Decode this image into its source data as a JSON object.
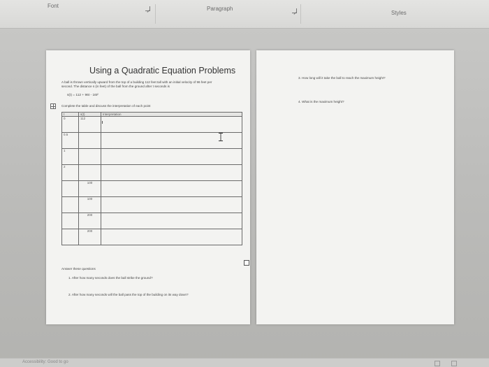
{
  "ribbon": {
    "font_label": "Font",
    "paragraph_label": "Paragraph",
    "styles_label": "Styles"
  },
  "worksheet": {
    "title": "Using a Quadratic Equation Problems",
    "intro_line1": "A ball is thrown vertically upward from the top of a building 112 feet tall with an initial velocity of 96 feet per",
    "intro_line2": "second. The distance s (in feet) of the ball from the ground after t seconds is",
    "formula": "s(t) = 112 + 96t - 16t²",
    "instruction": "Complete the table and discuss the interpretation of each point",
    "table": {
      "headers": [
        "t",
        "s(t)",
        "Interpretation"
      ],
      "rows": [
        [
          "0",
          "112",
          ""
        ],
        [
          "0.5",
          "",
          ""
        ],
        [
          "1",
          "",
          ""
        ],
        [
          "2",
          "",
          ""
        ],
        [
          "",
          "100",
          ""
        ],
        [
          "",
          "100",
          ""
        ],
        [
          "",
          "200",
          ""
        ],
        [
          "",
          "200",
          ""
        ]
      ]
    },
    "answer_heading": "Answer these questions",
    "question1": "1.  After how many seconds does the ball strike the ground?",
    "question2": "2.  After how many seconds will the ball pass the top of the building on its way down?",
    "question3": "3.  How long will it take the ball to reach the maximum height?",
    "question4": "4.  What is the maximum height?"
  },
  "statusbar": {
    "text": "Accessibility: Good to go"
  }
}
